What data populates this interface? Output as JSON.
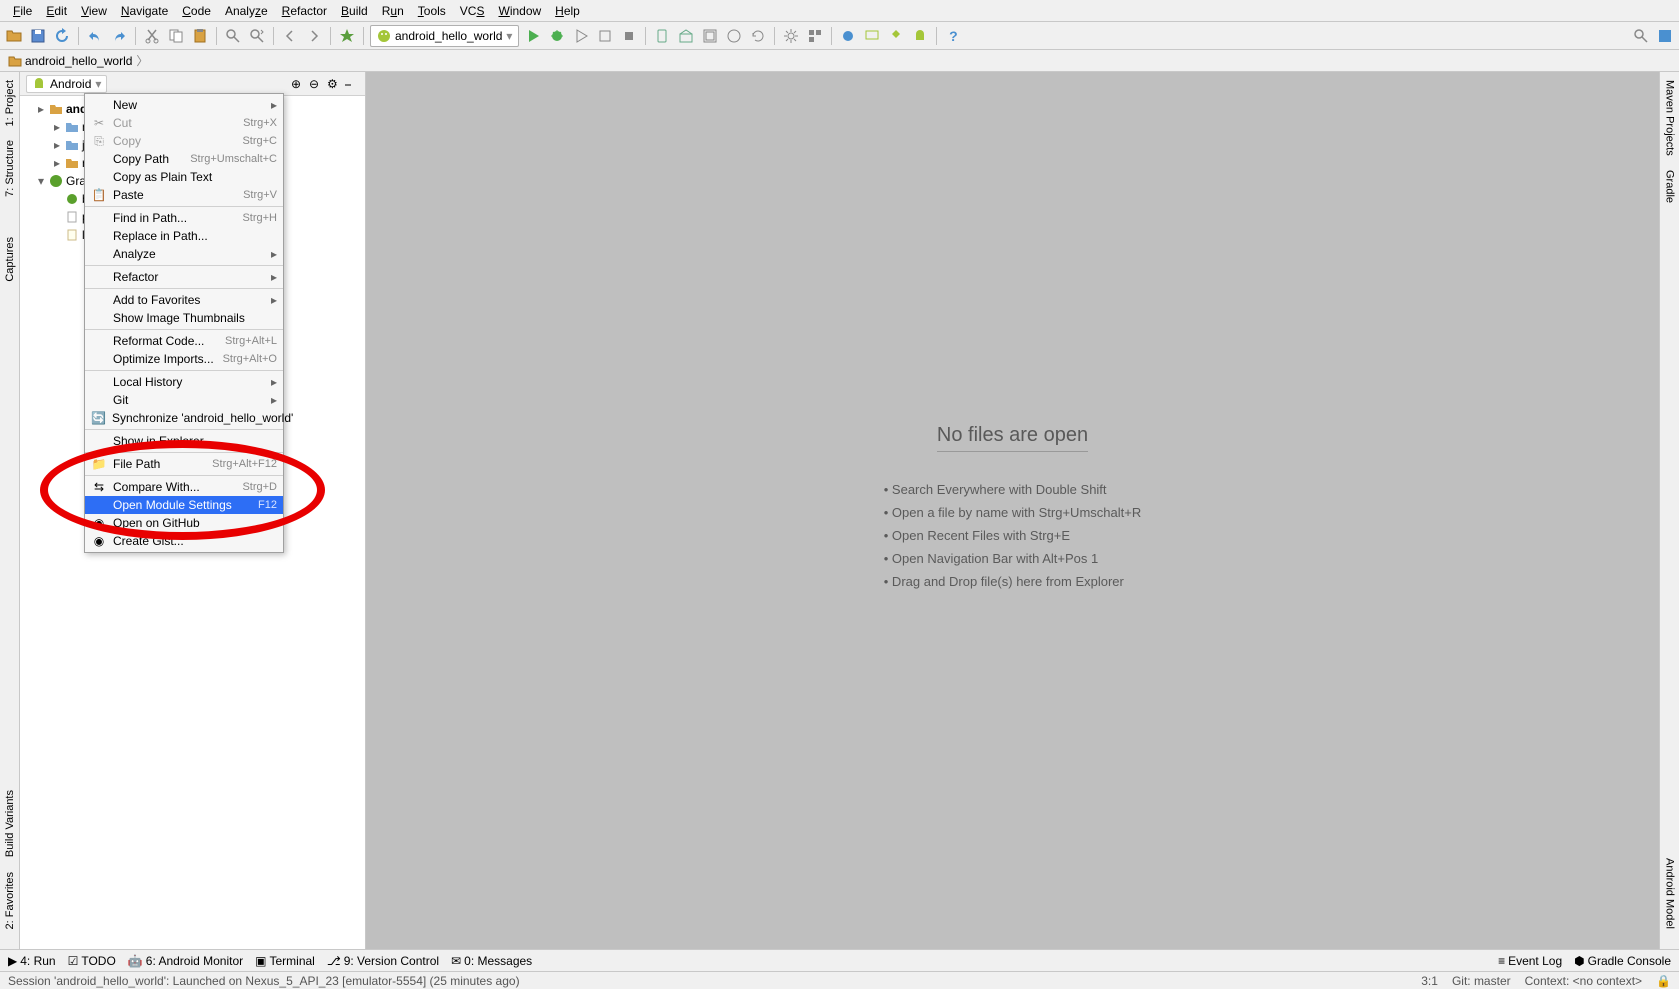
{
  "menubar": [
    "File",
    "Edit",
    "View",
    "Navigate",
    "Code",
    "Analyze",
    "Refactor",
    "Build",
    "Run",
    "Tools",
    "VCS",
    "Window",
    "Help"
  ],
  "run_config": "android_hello_world",
  "breadcrumb": {
    "project": "android_hello_world"
  },
  "project_panel": {
    "view_label": "Android",
    "tree": {
      "root": "android_hello_world",
      "items": [
        "manifests",
        "java",
        "res",
        "Gradle Scripts",
        "build.gradle",
        "proguard-rules.pro",
        "local.properties"
      ],
      "truncated": [
        "ma",
        "jav",
        "res",
        "Gradle",
        "bui",
        "pro",
        "loc"
      ]
    }
  },
  "sidebar_left": {
    "project": "1: Project",
    "structure": "7: Structure",
    "captures": "Captures",
    "build_variants": "Build Variants",
    "favorites": "2: Favorites"
  },
  "sidebar_right": {
    "maven": "Maven Projects",
    "gradle": "Gradle",
    "android_model": "Android Model"
  },
  "context_menu": {
    "items": [
      {
        "type": "item",
        "label": "New",
        "arrow": true
      },
      {
        "type": "item",
        "label": "Cut",
        "shortcut": "Strg+X",
        "disabled": true,
        "icon": "cut"
      },
      {
        "type": "item",
        "label": "Copy",
        "shortcut": "Strg+C",
        "disabled": true,
        "icon": "copy"
      },
      {
        "type": "item",
        "label": "Copy Path",
        "shortcut": "Strg+Umschalt+C"
      },
      {
        "type": "item",
        "label": "Copy as Plain Text"
      },
      {
        "type": "item",
        "label": "Paste",
        "shortcut": "Strg+V",
        "icon": "paste"
      },
      {
        "type": "sep"
      },
      {
        "type": "item",
        "label": "Find in Path...",
        "shortcut": "Strg+H"
      },
      {
        "type": "item",
        "label": "Replace in Path..."
      },
      {
        "type": "item",
        "label": "Analyze",
        "arrow": true
      },
      {
        "type": "sep"
      },
      {
        "type": "item",
        "label": "Refactor",
        "arrow": true
      },
      {
        "type": "sep"
      },
      {
        "type": "item",
        "label": "Add to Favorites",
        "arrow": true
      },
      {
        "type": "item",
        "label": "Show Image Thumbnails"
      },
      {
        "type": "sep"
      },
      {
        "type": "item",
        "label": "Reformat Code...",
        "shortcut": "Strg+Alt+L"
      },
      {
        "type": "item",
        "label": "Optimize Imports...",
        "shortcut": "Strg+Alt+O"
      },
      {
        "type": "sep"
      },
      {
        "type": "item",
        "label": "Local History",
        "arrow": true
      },
      {
        "type": "item",
        "label": "Git",
        "arrow": true
      },
      {
        "type": "item",
        "label": "Synchronize 'android_hello_world'",
        "icon": "sync"
      },
      {
        "type": "sep"
      },
      {
        "type": "item",
        "label": "Show in Explorer"
      },
      {
        "type": "sep"
      },
      {
        "type": "item",
        "label": "File Path",
        "shortcut": "Strg+Alt+F12",
        "icon": "folder"
      },
      {
        "type": "sep"
      },
      {
        "type": "item",
        "label": "Compare With...",
        "shortcut": "Strg+D",
        "icon": "diff"
      },
      {
        "type": "item",
        "label": "Open Module Settings",
        "shortcut": "F12",
        "highlighted": true
      },
      {
        "type": "item",
        "label": "Open on GitHub",
        "icon": "github"
      },
      {
        "type": "item",
        "label": "Create Gist...",
        "icon": "github"
      }
    ]
  },
  "empty_state": {
    "title": "No files are open",
    "hints": [
      "Search Everywhere with Double Shift",
      "Open a file by name with Strg+Umschalt+R",
      "Open Recent Files with Strg+E",
      "Open Navigation Bar with Alt+Pos 1",
      "Drag and Drop file(s) here from Explorer"
    ]
  },
  "bottom_tabs": {
    "left": [
      {
        "label": "4: Run",
        "icon": "run"
      },
      {
        "label": "TODO",
        "icon": "todo"
      },
      {
        "label": "6: Android Monitor",
        "icon": "android"
      },
      {
        "label": "Terminal",
        "icon": "terminal"
      },
      {
        "label": "9: Version Control",
        "icon": "vcs"
      },
      {
        "label": "0: Messages",
        "icon": "msg"
      }
    ],
    "right": [
      {
        "label": "Event Log",
        "icon": "log"
      },
      {
        "label": "Gradle Console",
        "icon": "gradle"
      }
    ]
  },
  "status_bar": {
    "message": "Session 'android_hello_world': Launched on Nexus_5_API_23 [emulator-5554] (25 minutes ago)",
    "cursor": "3:1",
    "git": "Git: master",
    "context": "Context: <no context>"
  }
}
